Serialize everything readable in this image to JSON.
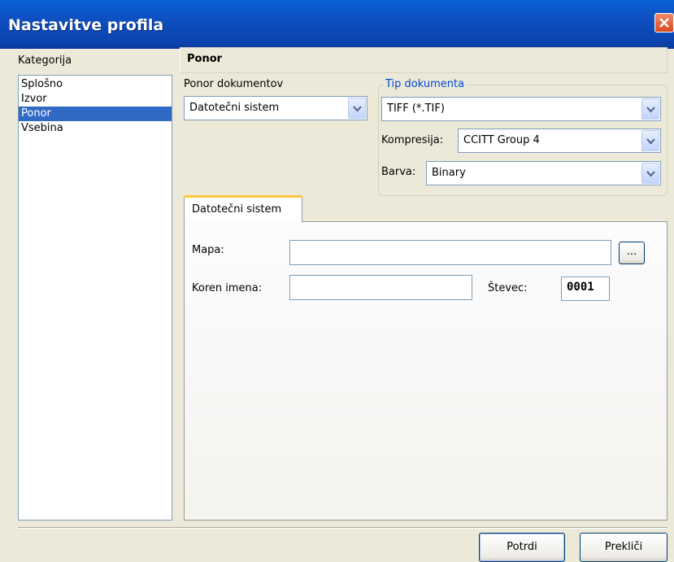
{
  "window": {
    "title": "Nastavitve profila"
  },
  "sidebar": {
    "label": "Kategorija",
    "items": [
      {
        "label": "Splošno",
        "selected": false
      },
      {
        "label": "Izvor",
        "selected": false
      },
      {
        "label": "Ponor",
        "selected": true
      },
      {
        "label": "Vsebina",
        "selected": false
      }
    ]
  },
  "section": {
    "title": "Ponor"
  },
  "sink": {
    "label": "Ponor dokumentov",
    "value": "Datotečni sistem"
  },
  "doc_type": {
    "legend": "Tip dokumenta",
    "type_value": "TIFF (*.TIF)",
    "compression_label": "Kompresija:",
    "compression_value": "CCITT Group 4",
    "color_label": "Barva:",
    "color_value": "Binary"
  },
  "tabs": [
    {
      "label": "Datotečni sistem",
      "active": true
    }
  ],
  "filesystem": {
    "folder_label": "Mapa:",
    "folder_value": "",
    "browse_label": "...",
    "name_root_label": "Koren imena:",
    "name_root_value": "",
    "counter_label": "Števec:",
    "counter_value": "0001"
  },
  "footer": {
    "ok_label": "Potrdi",
    "cancel_label": "Prekliči"
  },
  "colors": {
    "titlebar": "#0b4fc0",
    "selection": "#316ac5",
    "legend": "#0046d5",
    "tab_accent": "#ffc83c"
  }
}
